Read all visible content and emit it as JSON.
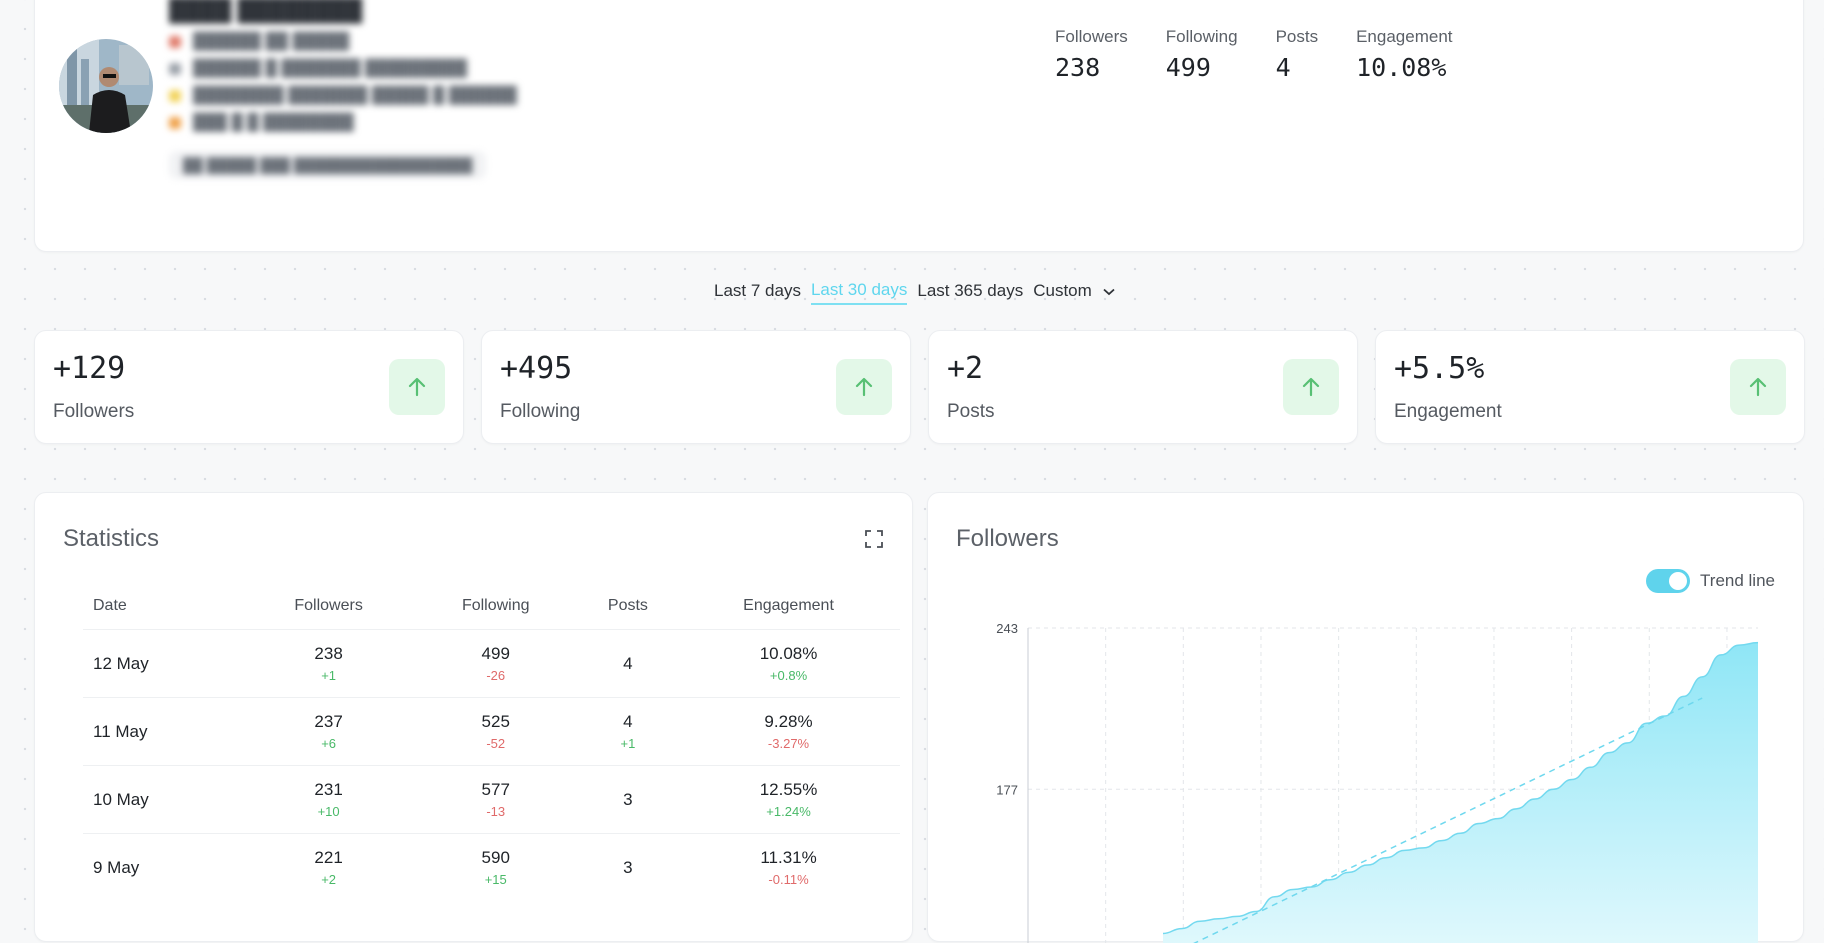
{
  "profile": {
    "stats": [
      {
        "label": "Followers",
        "value": "238"
      },
      {
        "label": "Following",
        "value": "499"
      },
      {
        "label": "Posts",
        "value": "4"
      },
      {
        "label": "Engagement",
        "value": "10.08%"
      }
    ]
  },
  "range": {
    "options": [
      "Last 7 days",
      "Last 30 days",
      "Last 365 days",
      "Custom"
    ],
    "active": "Last 30 days"
  },
  "kpis": [
    {
      "value": "+129",
      "label": "Followers"
    },
    {
      "value": "+495",
      "label": "Following"
    },
    {
      "value": "+2",
      "label": "Posts"
    },
    {
      "value": "+5.5%",
      "label": "Engagement"
    }
  ],
  "statistics": {
    "title": "Statistics",
    "columns": [
      "Date",
      "Followers",
      "Following",
      "Posts",
      "Engagement"
    ],
    "rows": [
      {
        "date": "12 May",
        "followers": "238",
        "followers_delta": "+1",
        "following": "499",
        "following_delta": "-26",
        "posts": "4",
        "posts_delta": "",
        "engagement": "10.08%",
        "engagement_delta": "+0.8%"
      },
      {
        "date": "11 May",
        "followers": "237",
        "followers_delta": "+6",
        "following": "525",
        "following_delta": "-52",
        "posts": "4",
        "posts_delta": "+1",
        "engagement": "9.28%",
        "engagement_delta": "-3.27%"
      },
      {
        "date": "10 May",
        "followers": "231",
        "followers_delta": "+10",
        "following": "577",
        "following_delta": "-13",
        "posts": "3",
        "posts_delta": "",
        "engagement": "12.55%",
        "engagement_delta": "+1.24%"
      },
      {
        "date": "9 May",
        "followers": "221",
        "followers_delta": "+2",
        "following": "590",
        "following_delta": "+15",
        "posts": "3",
        "posts_delta": "",
        "engagement": "11.31%",
        "engagement_delta": "-0.11%"
      }
    ]
  },
  "followers_chart": {
    "title": "Followers",
    "trend_label": "Trend line",
    "trend_on": true
  },
  "chart_data": {
    "type": "area",
    "y_ticks": [
      177,
      243
    ],
    "ylim": [
      110,
      243
    ],
    "values": [
      118,
      120,
      123,
      124,
      125,
      127,
      133,
      136,
      137,
      140,
      143,
      146,
      149,
      152,
      153,
      156,
      159,
      163,
      165,
      169,
      173,
      177,
      181,
      186,
      192,
      196,
      204,
      207,
      215,
      223,
      232,
      236,
      237
    ],
    "trend_line": true,
    "colors": {
      "fill": "#8fe6f6",
      "line": "#73d9ef"
    }
  },
  "colors": {
    "accent": "#5fd6ee",
    "positive": "#49b968",
    "negative": "#e06a6a",
    "arrow_bg": "#e3f8e8",
    "arrow": "#58c074"
  }
}
